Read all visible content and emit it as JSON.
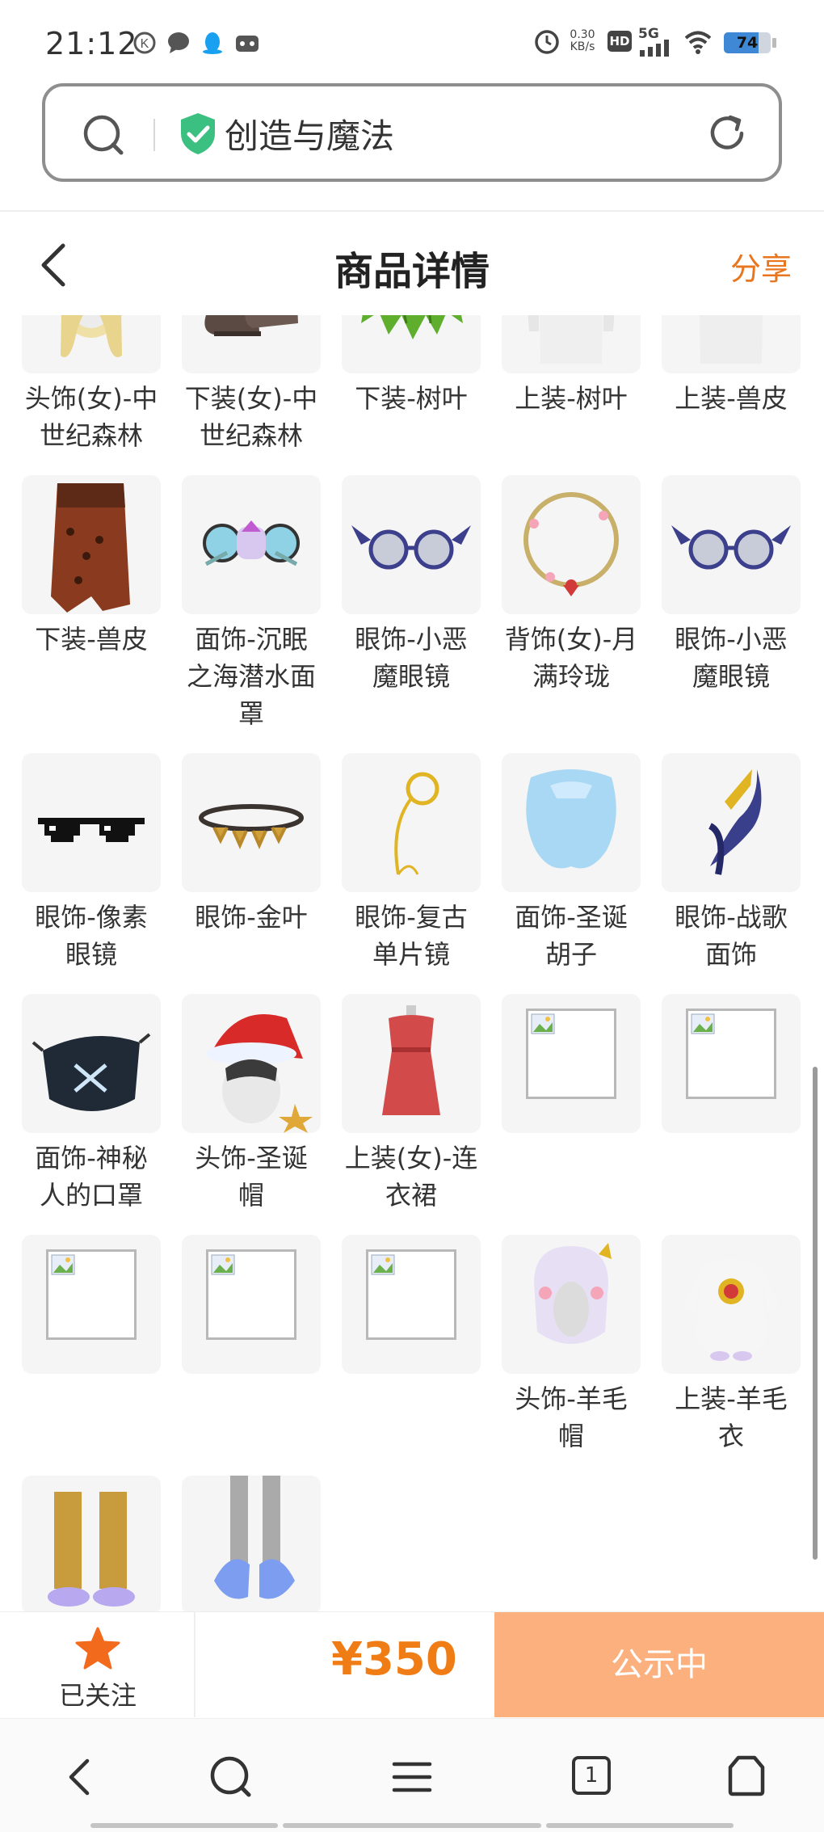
{
  "status_bar": {
    "time": "21:12",
    "net_speed_top": "0.30",
    "net_speed_bottom": "KB/s",
    "hd": "HD",
    "network": "5G",
    "battery": "74"
  },
  "search_bar": {
    "text": "创造与魔法"
  },
  "header": {
    "title": "商品详情",
    "share": "分享"
  },
  "items": [
    {
      "name": "头饰(女)-中世纪森林",
      "icon": "hair-icon"
    },
    {
      "name": "下装(女)-中世纪森林",
      "icon": "boots-icon"
    },
    {
      "name": "下装-树叶",
      "icon": "leaf-skirt-icon"
    },
    {
      "name": "上装-树叶",
      "icon": "leaf-top-icon"
    },
    {
      "name": "上装-兽皮",
      "icon": "hide-top-icon"
    },
    {
      "name": "下装-兽皮",
      "icon": "hide-skirt-icon"
    },
    {
      "name": "面饰-沉眠之海潜水面罩",
      "icon": "diving-mask-icon"
    },
    {
      "name": "眼饰-小恶魔眼镜",
      "icon": "devil-glasses-icon"
    },
    {
      "name": "背饰(女)-月满玲珑",
      "icon": "wreath-icon"
    },
    {
      "name": "眼饰-小恶魔眼镜",
      "icon": "devil-glasses-icon"
    },
    {
      "name": "眼饰-像素眼镜",
      "icon": "pixel-glasses-icon"
    },
    {
      "name": "眼饰-金叶",
      "icon": "gold-leaf-icon"
    },
    {
      "name": "眼饰-复古单片镜",
      "icon": "monocle-icon"
    },
    {
      "name": "面饰-圣诞胡子",
      "icon": "beard-icon"
    },
    {
      "name": "眼饰-战歌面饰",
      "icon": "warsong-mask-icon"
    },
    {
      "name": "面饰-神秘人的口罩",
      "icon": "face-mask-icon"
    },
    {
      "name": "头饰-圣诞帽",
      "icon": "santa-hat-icon"
    },
    {
      "name": "上装(女)-连衣裙",
      "icon": "dress-icon"
    },
    {
      "name": "",
      "icon": "broken-image-icon"
    },
    {
      "name": "",
      "icon": "broken-image-icon"
    },
    {
      "name": "",
      "icon": "broken-image-icon"
    },
    {
      "name": "",
      "icon": "broken-image-icon"
    },
    {
      "name": "",
      "icon": "broken-image-icon"
    },
    {
      "name": "头饰-羊毛帽",
      "icon": "sheep-hat-icon"
    },
    {
      "name": "上装-羊毛衣",
      "icon": "sheep-coat-icon"
    },
    {
      "name": "",
      "icon": "gold-boots-icon"
    },
    {
      "name": "",
      "icon": "blue-shoes-icon"
    }
  ],
  "action_bar": {
    "follow_label": "已关注",
    "price": "¥350",
    "status_button": "公示中",
    "accent_color": "#f07c16",
    "button_color": "#fbb07d"
  },
  "nav_bar": {
    "tab_count": "1"
  }
}
